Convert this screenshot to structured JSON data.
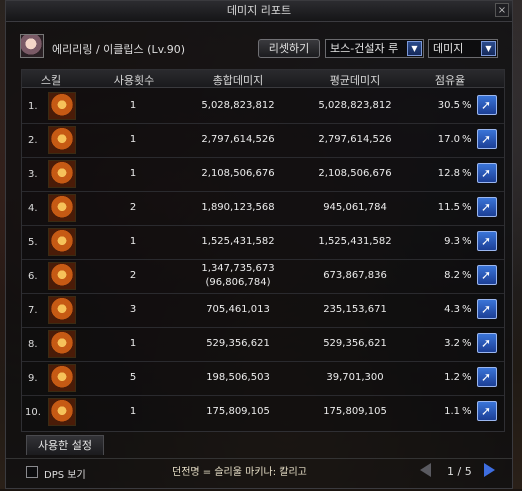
{
  "window": {
    "title": "데미지 리포트",
    "close": "×"
  },
  "character": {
    "name": "에리리링 / 이클립스 (Lv.90)"
  },
  "controls": {
    "reset_label": "리셋하기",
    "boss_select": "보스-건설자 루",
    "metric_select": "데미지"
  },
  "table": {
    "headers": {
      "skill": "스킬",
      "count": "사용횟수",
      "total": "총합데미지",
      "average": "평균데미지",
      "share": "점유율"
    },
    "rows": [
      {
        "rank": "1.",
        "count": "1",
        "total": "5,028,823,812",
        "total_sub": "",
        "avg": "5,028,823,812",
        "share": "30.5",
        "pct": "%"
      },
      {
        "rank": "2.",
        "count": "1",
        "total": "2,797,614,526",
        "total_sub": "",
        "avg": "2,797,614,526",
        "share": "17.0",
        "pct": "%"
      },
      {
        "rank": "3.",
        "count": "1",
        "total": "2,108,506,676",
        "total_sub": "",
        "avg": "2,108,506,676",
        "share": "12.8",
        "pct": "%"
      },
      {
        "rank": "4.",
        "count": "2",
        "total": "1,890,123,568",
        "total_sub": "",
        "avg": "945,061,784",
        "share": "11.5",
        "pct": "%"
      },
      {
        "rank": "5.",
        "count": "1",
        "total": "1,525,431,582",
        "total_sub": "",
        "avg": "1,525,431,582",
        "share": "9.3",
        "pct": "%"
      },
      {
        "rank": "6.",
        "count": "2",
        "total": "1,347,735,673",
        "total_sub": "(96,806,784)",
        "avg": "673,867,836",
        "share": "8.2",
        "pct": "%"
      },
      {
        "rank": "7.",
        "count": "3",
        "total": "705,461,013",
        "total_sub": "",
        "avg": "235,153,671",
        "share": "4.3",
        "pct": "%"
      },
      {
        "rank": "8.",
        "count": "1",
        "total": "529,356,621",
        "total_sub": "",
        "avg": "529,356,621",
        "share": "3.2",
        "pct": "%"
      },
      {
        "rank": "9.",
        "count": "5",
        "total": "198,506,503",
        "total_sub": "",
        "avg": "39,701,300",
        "share": "1.2",
        "pct": "%"
      },
      {
        "rank": "10.",
        "count": "1",
        "total": "175,809,105",
        "total_sub": "",
        "avg": "175,809,105",
        "share": "1.1",
        "pct": "%"
      }
    ]
  },
  "tabs": {
    "used_settings": "사용한 설정"
  },
  "footer": {
    "dps_label": "DPS 보기",
    "text": "던전명 = 슬리울 마키나: 칼리고",
    "page": "1 / 5"
  },
  "colors": {
    "accent_blue": "#3a74d8",
    "icon_orange": "#c65a14"
  }
}
